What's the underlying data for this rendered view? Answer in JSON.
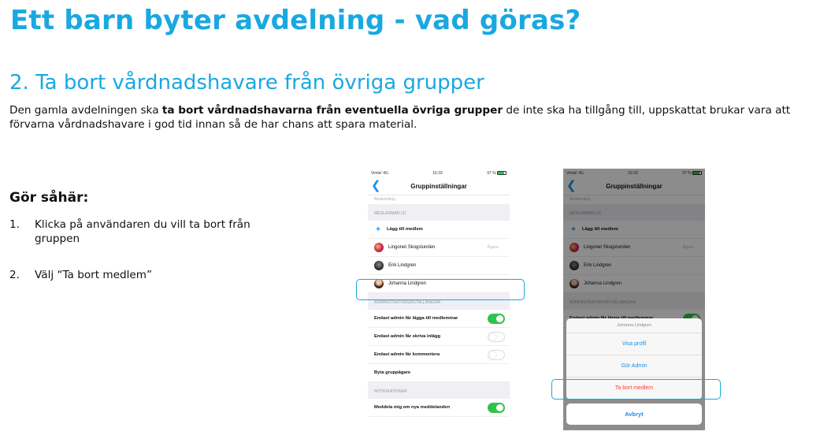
{
  "title": "Ett barn byter avdelning - vad göras?",
  "subtitle": "2. Ta bort vårdnadshavare från övriga grupper",
  "intro": {
    "before": "Den gamla avdelningen ska ",
    "bold": "ta bort vårdnadshavarna från eventuella övriga grupper",
    "after": " de inte ska ha tillgång till, uppskattat brukar vara att förvarna vårdnadshavare i god tid innan så de har chans att spara material."
  },
  "howto": {
    "heading": "Gör såhär:",
    "steps": [
      {
        "num": "1.",
        "text": "Klicka på användaren du vill ta bort från gruppen"
      },
      {
        "num": "2.",
        "text": "Välj “Ta bort medlem”"
      }
    ]
  },
  "phone": {
    "carrier": "Vimla! 4G",
    "time": "16:33",
    "battery": "97 %",
    "back_glyph": "❮",
    "nav_title": "Gruppinställningar",
    "description_placeholder": "Beskrivning...",
    "members_header": "MEDLEMMAR (3)",
    "add_member": "Lägg till medlem",
    "members": [
      {
        "name": "Lingonet Skogslunden",
        "meta": "Ägare"
      },
      {
        "name": "Erik Lindgren",
        "meta": ""
      },
      {
        "name": "Johanna Lindgren",
        "meta": ""
      }
    ],
    "admin_header": "ADMINISTRATÖRSINSTÄLLNINGAR",
    "admin_settings": [
      {
        "label": "Endast admin får lägga till medlemmar",
        "on": true
      },
      {
        "label": "Endast admin får skriva inlägg",
        "on": false
      },
      {
        "label": "Endast admin får kommentera",
        "on": false
      }
    ],
    "change_owner": "Byta gruppägare",
    "notifications_header": "NOTIFIKATIONER",
    "notify_label": "Meddela mig om nya meddelanden",
    "notify_on": true
  },
  "action_sheet": {
    "title": "Johanna Lindgren",
    "view_profile": "Visa profil",
    "make_admin": "Gör Admin",
    "remove_member": "Ta bort medlem",
    "cancel": "Avbryt"
  },
  "colors": {
    "accent": "#1aa8e0",
    "ios_blue": "#1a8fe8",
    "toggle_on": "#2ec44a",
    "danger": "#ff3b30"
  }
}
